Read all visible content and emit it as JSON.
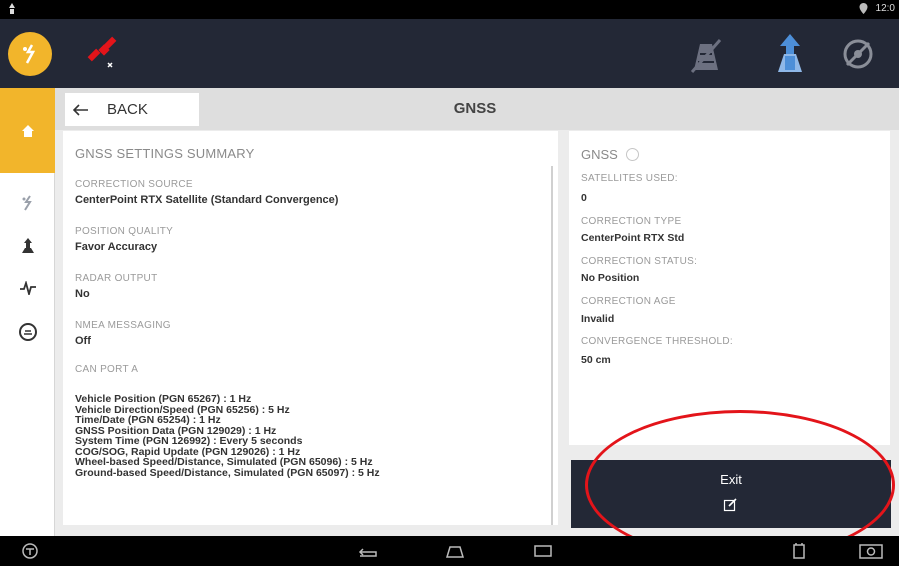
{
  "app": {
    "title": "GNSS",
    "back_label": "BACK"
  },
  "colors": {
    "accent": "#f2b52b",
    "bar": "#232836",
    "highlight": "#e3141a"
  },
  "statusbar": {
    "time": "12:0"
  },
  "icons": {
    "topbar": [
      "gps-icon",
      "satellite-off-icon",
      "field-disabled-icon",
      "auto-steer-icon",
      "steering-off-icon"
    ],
    "leftnav": [
      "home-icon",
      "gps-icon",
      "guidance-icon",
      "signal-icon",
      "speed-icon"
    ],
    "sysnav": [
      "settings-icon",
      "back-icon",
      "home-icon",
      "recents-icon",
      "device-icon",
      "screenshot-icon"
    ]
  },
  "summary": {
    "title": "GNSS SETTINGS SUMMARY",
    "correction_source_label": "CORRECTION SOURCE",
    "correction_source_value": "CenterPoint RTX Satellite (Standard Convergence)",
    "position_quality_label": "POSITION QUALITY",
    "position_quality_value": "Favor Accuracy",
    "radar_output_label": "RADAR OUTPUT",
    "radar_output_value": "No",
    "nmea_label": "NMEA MESSAGING",
    "nmea_value": "Off",
    "can_port_label": "CAN PORT A",
    "can_messages": [
      "Vehicle Position (PGN 65267) : 1 Hz",
      "Vehicle Direction/Speed (PGN 65256) : 5 Hz",
      "Time/Date (PGN 65254) : 1 Hz",
      "GNSS Position Data (PGN 129029) : 1 Hz",
      "System Time (PGN 126992) : Every 5 seconds",
      "COG/SOG, Rapid Update (PGN 129026) : 1 Hz",
      "Wheel-based Speed/Distance, Simulated (PGN 65096) : 5 Hz",
      "Ground-based Speed/Distance, Simulated (PGN 65097) : 5 Hz"
    ]
  },
  "status": {
    "title": "GNSS",
    "satellites_label": "SATELLITES USED:",
    "satellites_value": "0",
    "correction_type_label": "CORRECTION TYPE",
    "correction_type_value": "CenterPoint RTX Std",
    "correction_status_label": "CORRECTION STATUS:",
    "correction_status_value": "No Position",
    "correction_age_label": "CORRECTION AGE",
    "correction_age_value": "Invalid",
    "convergence_label": "CONVERGENCE THRESHOLD:",
    "convergence_value": "50 cm"
  },
  "exit": {
    "label": "Exit"
  }
}
